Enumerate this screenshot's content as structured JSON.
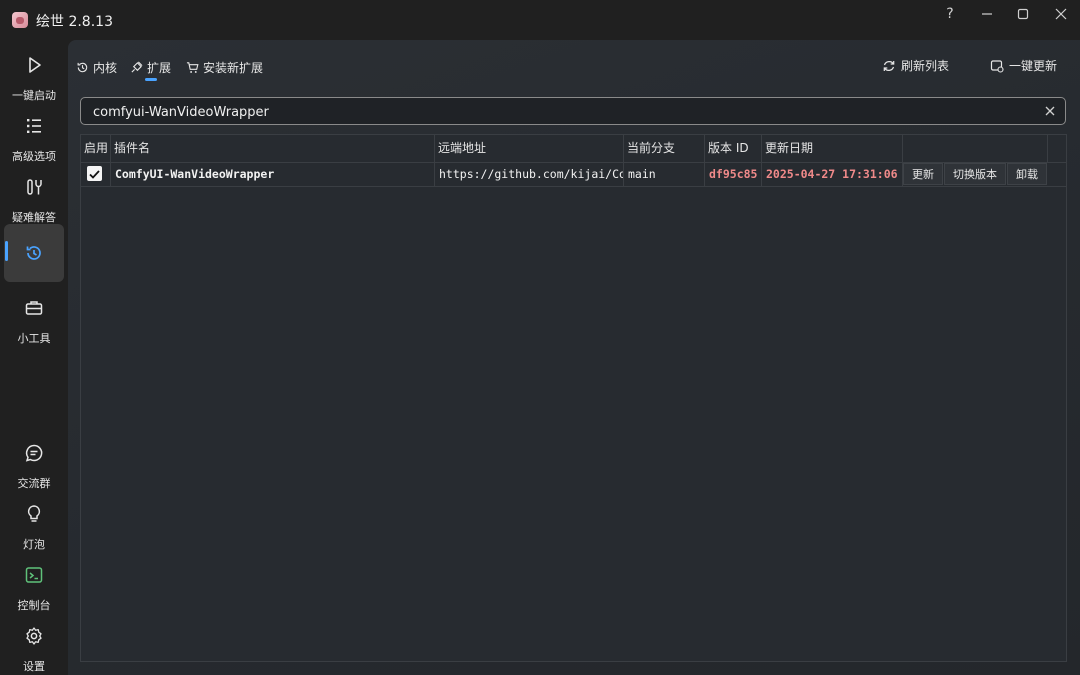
{
  "window": {
    "title": "绘世 2.8.13",
    "help": "?"
  },
  "sidebar": {
    "items": [
      {
        "label": "一键启动",
        "icon": "play-icon"
      },
      {
        "label": "高级选项",
        "icon": "list-icon"
      },
      {
        "label": "疑难解答",
        "icon": "wrench-icon"
      },
      {
        "label": "",
        "icon": "history-icon"
      },
      {
        "label": "小工具",
        "icon": "toolbox-icon"
      },
      {
        "label": "交流群",
        "icon": "chat-icon"
      },
      {
        "label": "灯泡",
        "icon": "bulb-icon"
      },
      {
        "label": "控制台",
        "icon": "terminal-icon"
      },
      {
        "label": "设置",
        "icon": "gear-icon"
      }
    ],
    "accent": "#4aa3ff"
  },
  "tabs": [
    {
      "label": "内核",
      "icon": "history-icon"
    },
    {
      "label": "扩展",
      "icon": "plug-icon"
    },
    {
      "label": "安装新扩展",
      "icon": "cart-icon"
    }
  ],
  "actions": {
    "refresh": "刷新列表",
    "update_all": "一键更新"
  },
  "search": {
    "value": "comfyui-WanVideoWrapper"
  },
  "table": {
    "headers": [
      "启用",
      "插件名",
      "远端地址",
      "当前分支",
      "版本 ID",
      "更新日期",
      ""
    ],
    "rows": [
      {
        "enabled": true,
        "name": "ComfyUI-WanVideoWrapper",
        "remote": "https://github.com/kijai/ComfyUI-WanVideoWrapper",
        "branch": "main",
        "version": "df95c85",
        "date": "2025-04-27 17:31:06",
        "buttons": [
          "更新",
          "切换版本",
          "卸载"
        ]
      }
    ],
    "highlight_color": "#f08a8a"
  }
}
